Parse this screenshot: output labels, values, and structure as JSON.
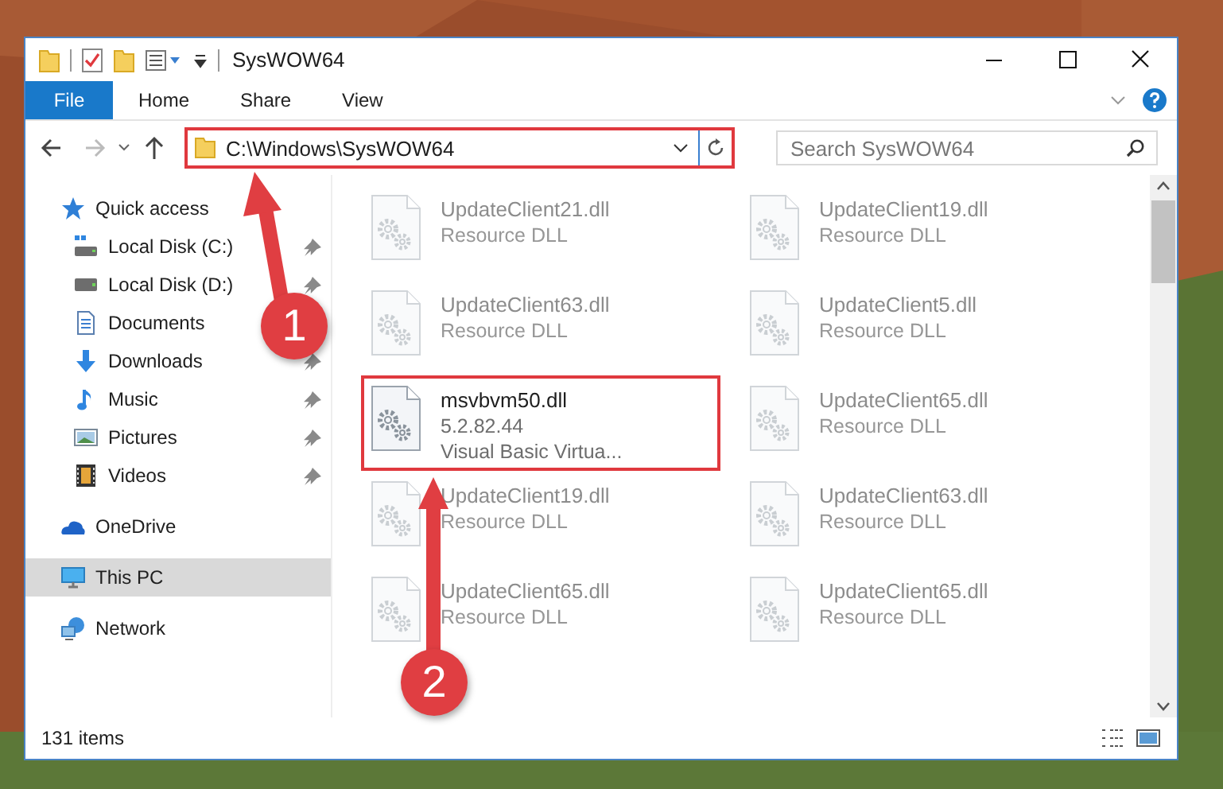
{
  "window": {
    "title": "SysWOW64"
  },
  "ribbon": {
    "tabs": [
      {
        "label": "File",
        "kind": "file"
      },
      {
        "label": "Home",
        "kind": "tab"
      },
      {
        "label": "Share",
        "kind": "tab"
      },
      {
        "label": "View",
        "kind": "tab"
      }
    ]
  },
  "address_bar": {
    "path": "C:\\Windows\\SysWOW64",
    "highlighted": true
  },
  "search": {
    "placeholder": "Search SysWOW64"
  },
  "sidebar": {
    "items": [
      {
        "label": "Quick access",
        "kind": "quick-access",
        "selected": false,
        "children": [
          {
            "label": "Local Disk (C:)",
            "kind": "system-drive",
            "pinned": true,
            "selected": false
          },
          {
            "label": "Local Disk (D:)",
            "kind": "drive",
            "pinned": true,
            "selected": false
          },
          {
            "label": "Documents",
            "kind": "documents",
            "selected": false
          },
          {
            "label": "Downloads",
            "kind": "downloads",
            "pinned": true,
            "selected": false
          },
          {
            "label": "Music",
            "kind": "music",
            "pinned": true,
            "selected": false
          },
          {
            "label": "Pictures",
            "kind": "pictures",
            "pinned": true,
            "selected": false
          },
          {
            "label": "Videos",
            "kind": "videos",
            "pinned": true,
            "selected": false
          }
        ]
      },
      {
        "label": "OneDrive",
        "kind": "cloud",
        "selected": false
      },
      {
        "label": "This PC",
        "kind": "computer",
        "selected": true
      },
      {
        "label": "Network",
        "kind": "network",
        "selected": false
      }
    ]
  },
  "files": [
    {
      "name": "UpdateClient21.dll",
      "details": [
        "Resource DLL"
      ],
      "blurred": true,
      "highlighted": false
    },
    {
      "name": "UpdateClient19.dll",
      "details": [
        "Resource DLL"
      ],
      "blurred": true,
      "highlighted": false
    },
    {
      "name": "UpdateClient63.dll",
      "details": [
        "Resource DLL"
      ],
      "blurred": true,
      "highlighted": false
    },
    {
      "name": "UpdateClient5.dll",
      "details": [
        "Resource DLL"
      ],
      "blurred": true,
      "highlighted": false
    },
    {
      "name": "msvbvm50.dll",
      "details": [
        "5.2.82.44",
        "Visual Basic Virtua..."
      ],
      "blurred": false,
      "highlighted": true
    },
    {
      "name": "UpdateClient65.dll",
      "details": [
        "Resource DLL"
      ],
      "blurred": true,
      "highlighted": false
    },
    {
      "name": "UpdateClient19.dll",
      "details": [
        "Resource DLL"
      ],
      "blurred": true,
      "highlighted": false
    },
    {
      "name": "UpdateClient63.dll",
      "details": [
        "Resource DLL"
      ],
      "blurred": true,
      "highlighted": false
    },
    {
      "name": "UpdateClient65.dll",
      "details": [
        "Resource DLL"
      ],
      "blurred": true,
      "highlighted": false
    },
    {
      "name": "UpdateClient65.dll",
      "details": [
        "Resource DLL"
      ],
      "blurred": true,
      "highlighted": false
    }
  ],
  "status_bar": {
    "item_count": "131 items"
  },
  "annotations": [
    {
      "label": "1"
    },
    {
      "label": "2"
    }
  ]
}
